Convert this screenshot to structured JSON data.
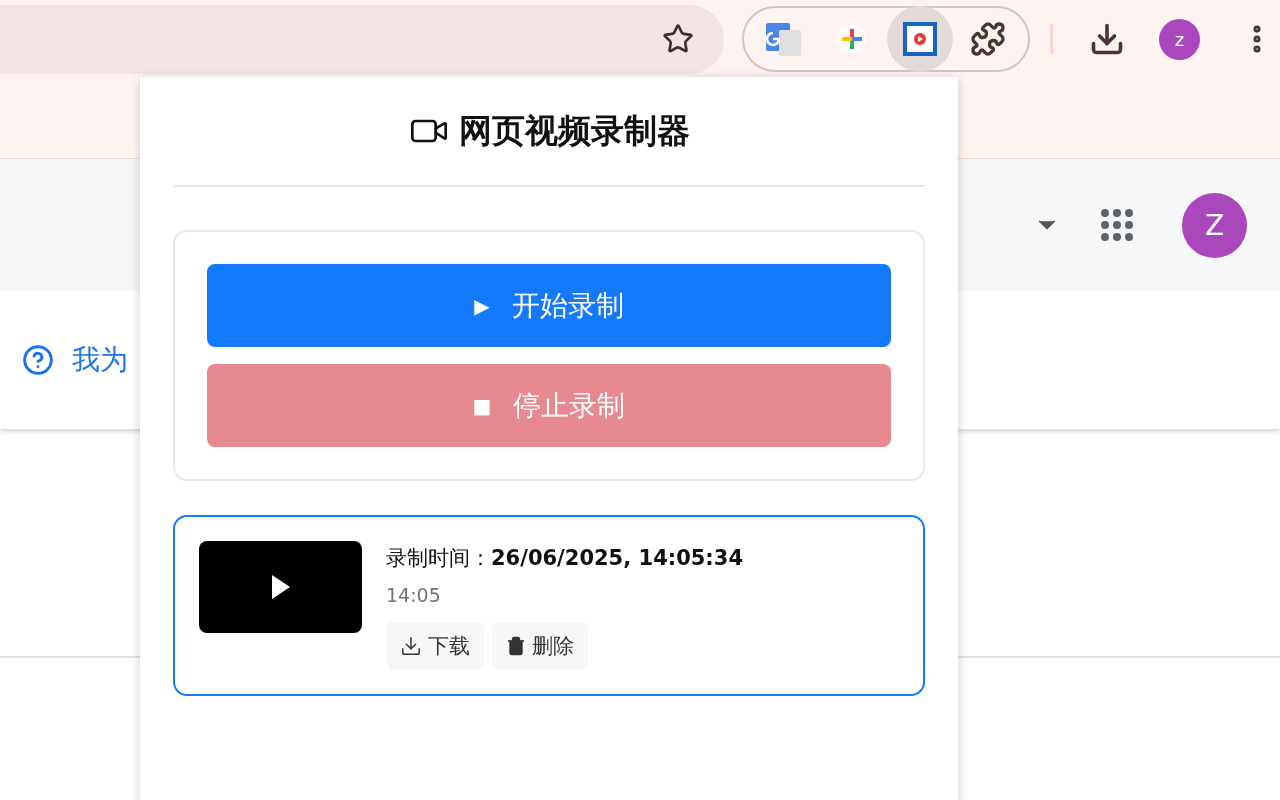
{
  "toolbar": {
    "avatar": "z"
  },
  "page": {
    "avatar": "Z",
    "help_link": "我为"
  },
  "popup": {
    "title": "网页视频录制器",
    "controls": [
      {
        "kind": "start",
        "icon": "▶",
        "label": "开始录制",
        "disabled": false
      },
      {
        "kind": "stop",
        "icon": "■",
        "label": "停止录制",
        "disabled": true
      }
    ],
    "recordings": [
      {
        "label": "录制时间：",
        "time": "26/06/2025, 14:05:34",
        "duration": "14:05",
        "actions": [
          {
            "kind": "download",
            "label": "下载"
          },
          {
            "kind": "delete",
            "label": "删除"
          }
        ]
      }
    ]
  }
}
